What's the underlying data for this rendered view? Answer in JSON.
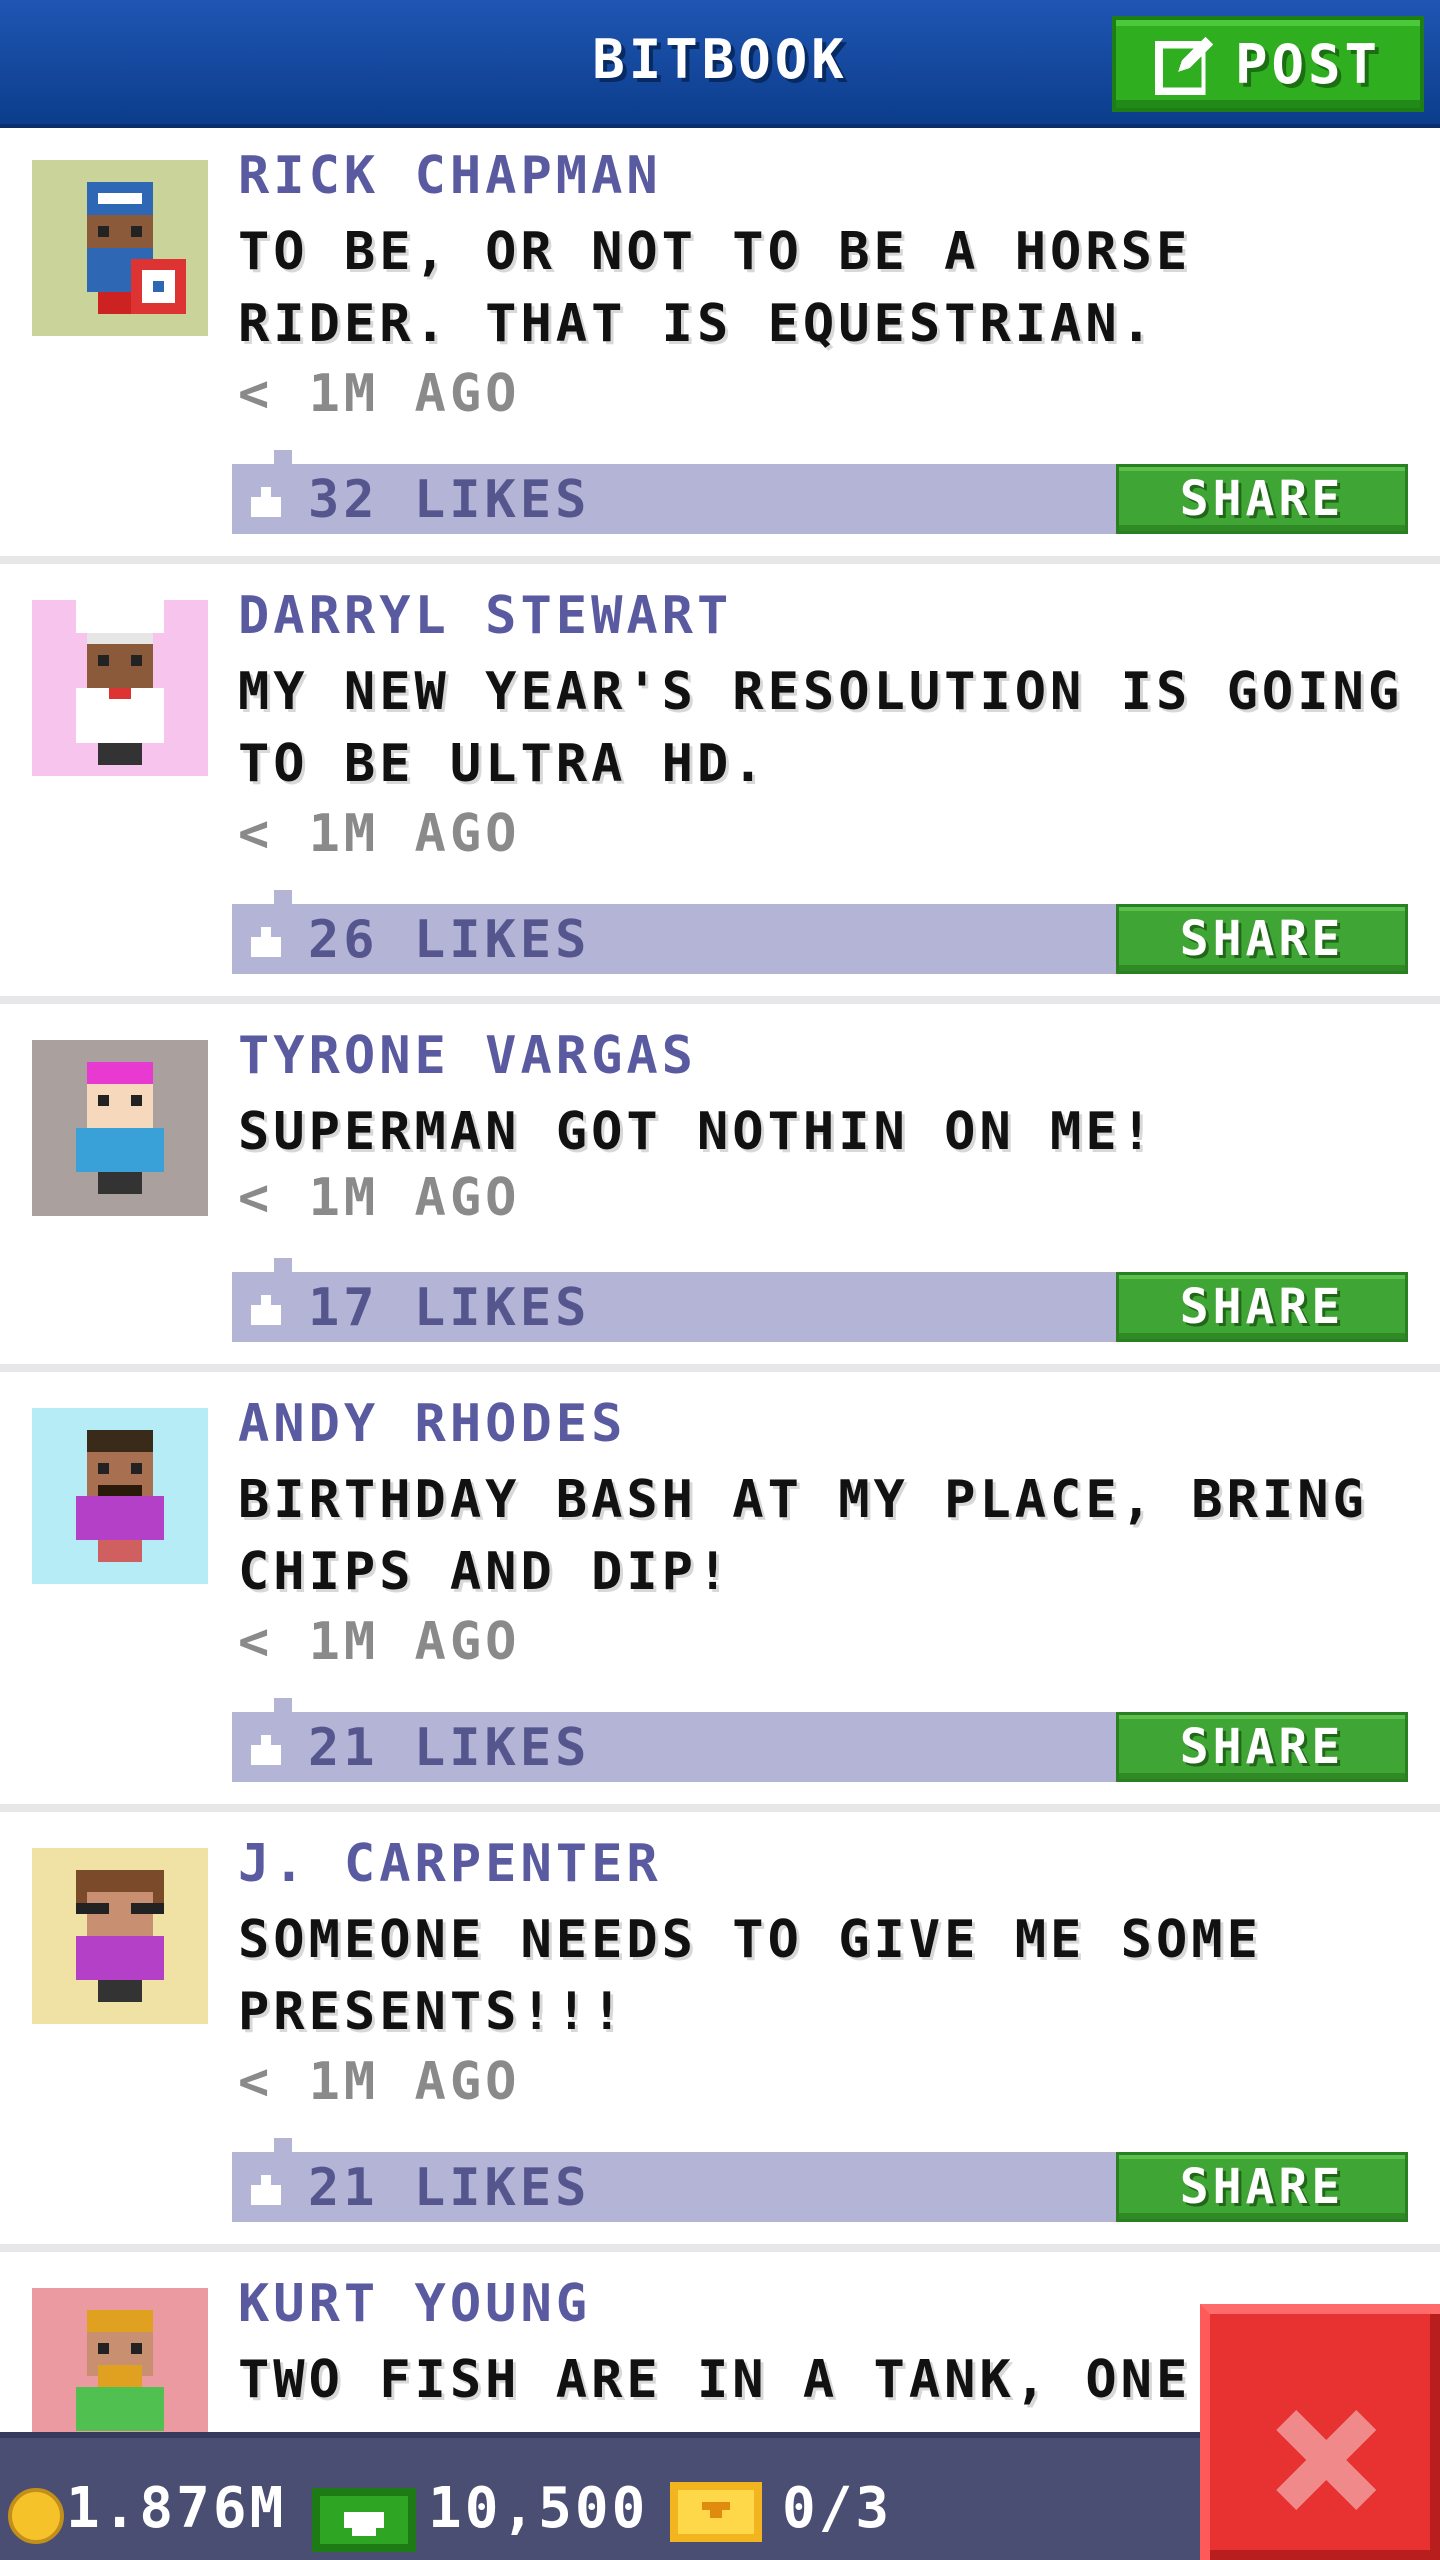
{
  "header": {
    "title": "BITBOOK",
    "post_label": "POST"
  },
  "posts": [
    {
      "author": "RICK CHAPMAN",
      "message": "TO BE, OR NOT TO BE A HORSE RIDER. THAT IS EQUESTRIAN.",
      "time": "< 1M AGO",
      "likes": "32 LIKES",
      "share_label": "SHARE",
      "avatar_bg": "#c9d39a"
    },
    {
      "author": "DARRYL STEWART",
      "message": "MY NEW YEAR'S RESOLUTION IS GOING TO BE ULTRA HD.",
      "time": "< 1M AGO",
      "likes": "26 LIKES",
      "share_label": "SHARE",
      "avatar_bg": "#f7c4ee"
    },
    {
      "author": "TYRONE VARGAS",
      "message": "SUPERMAN GOT NOTHIN ON ME!",
      "time": "< 1M AGO",
      "likes": "17 LIKES",
      "share_label": "SHARE",
      "avatar_bg": "#aaa09e"
    },
    {
      "author": "ANDY RHODES",
      "message": "BIRTHDAY BASH AT MY PLACE, BRING CHIPS AND DIP!",
      "time": "< 1M AGO",
      "likes": "21 LIKES",
      "share_label": "SHARE",
      "avatar_bg": "#b6ecf6"
    },
    {
      "author": "J. CARPENTER",
      "message": "SOMEONE NEEDS TO GIVE ME SOME PRESENTS!!!",
      "time": "< 1M AGO",
      "likes": "21 LIKES",
      "share_label": "SHARE",
      "avatar_bg": "#f0e2a4"
    },
    {
      "author": "KURT YOUNG",
      "message": "TWO FISH ARE IN A TANK, ONE T",
      "avatar_bg": "#eb9aa2"
    }
  ],
  "status": {
    "coins": "1.876M",
    "bux": "10,500",
    "tickets": "0/3"
  },
  "icons": {
    "post": "edit-icon",
    "like": "thumbs-up-icon",
    "coin": "coin-icon",
    "bux": "bux-icon",
    "ticket": "ticket-icon",
    "close": "close-icon"
  },
  "colors": {
    "header": "#1f56b3",
    "accent_green": "#3fa535",
    "likes_bar": "#b3b4d6",
    "author_text": "#5a5aa0",
    "close_red": "#e83232"
  }
}
